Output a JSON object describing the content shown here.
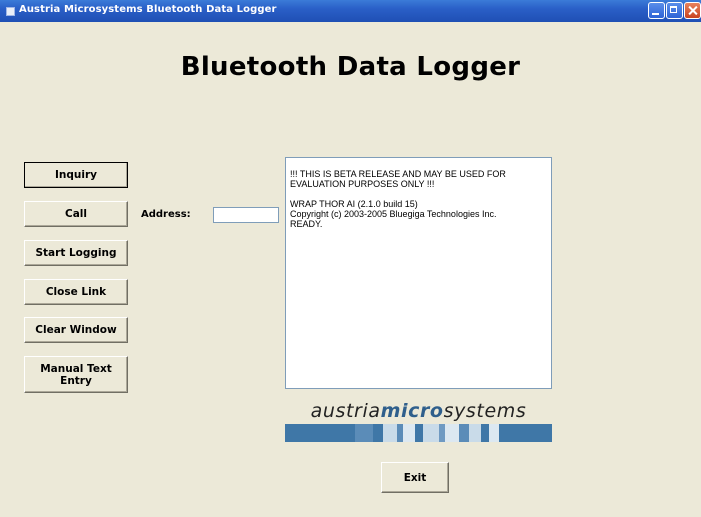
{
  "window": {
    "title": "Austria Microsystems Bluetooth Data Logger",
    "minimize_icon": "minimize-icon",
    "maximize_icon": "maximize-icon",
    "close_icon": "close-icon"
  },
  "heading": "Bluetooth Data Logger",
  "buttons": {
    "inquiry": "Inquiry",
    "call": "Call",
    "start_logging": "Start Logging",
    "close_link": "Close Link",
    "clear_window": "Clear Window",
    "manual_text_entry": "Manual Text Entry",
    "exit": "Exit"
  },
  "address": {
    "label": "Address:",
    "value": ""
  },
  "output": {
    "text": "!!! THIS IS BETA RELEASE AND MAY BE USED FOR\nEVALUATION PURPOSES ONLY !!!\n\nWRAP THOR AI (2.1.0 build 15)\nCopyright (c) 2003-2005 Bluegiga Technologies Inc.\nREADY."
  },
  "logo": {
    "part1": "austria",
    "part2": "micro",
    "part3": "systems",
    "colors": {
      "accent": "#2f5f8c",
      "bar_dark": "#3f77a7",
      "bar_light": "#c9dbe9"
    }
  },
  "colors": {
    "titlebar": "#2a5fc7",
    "background": "#ece9d8"
  }
}
